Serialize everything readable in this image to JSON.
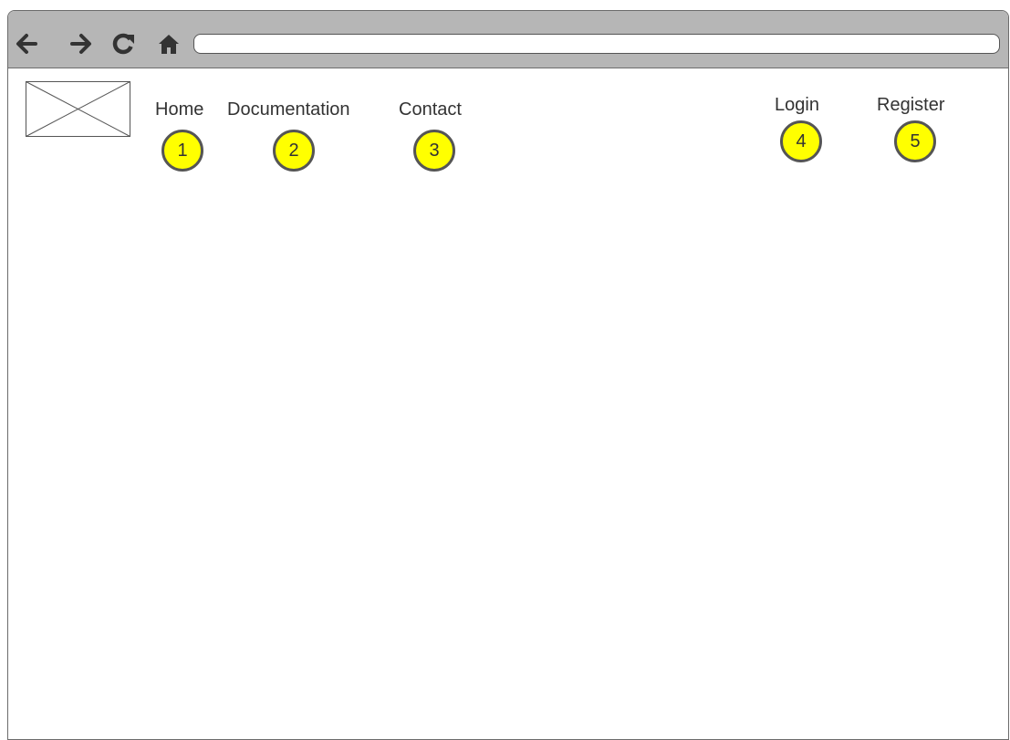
{
  "browser": {
    "address": "",
    "icons": {
      "back": "arrow-left-icon",
      "forward": "arrow-right-icon",
      "reload": "reload-icon",
      "home": "home-icon"
    },
    "colors": {
      "toolbar": "#b6b6b6",
      "icon": "#333333"
    }
  },
  "header": {
    "logo": "image-placeholder-icon",
    "nav": {
      "home": "Home",
      "documentation": "Documentation",
      "contact": "Contact"
    },
    "auth": {
      "login": "Login",
      "register": "Register"
    }
  },
  "annotations": {
    "markers": [
      "1",
      "2",
      "3",
      "4",
      "5"
    ],
    "color": "#ffff00"
  }
}
